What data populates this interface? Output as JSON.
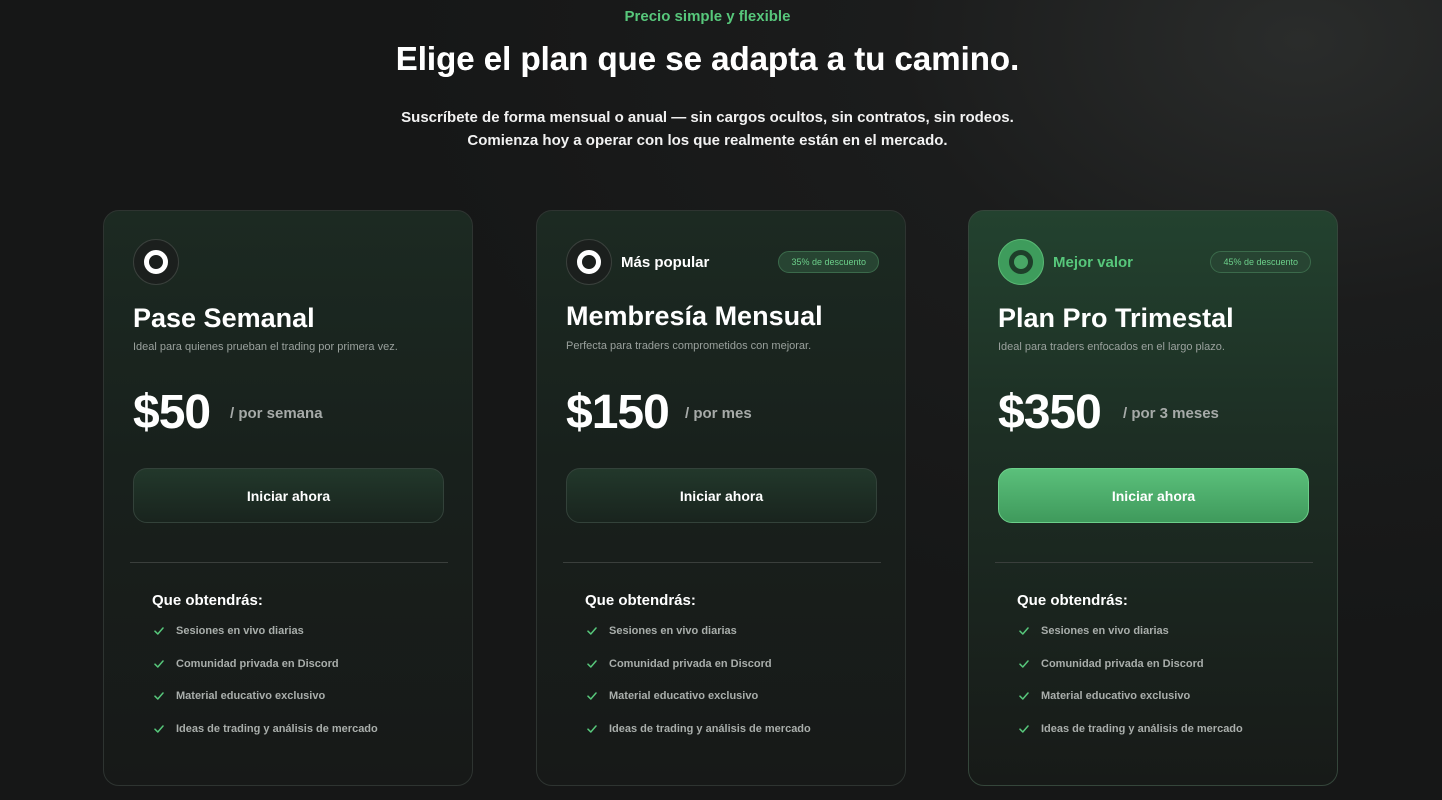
{
  "header": {
    "eyebrow": "Precio simple y flexible",
    "title": "Elige el plan que se adapta a tu camino.",
    "subtitle_line1": "Suscríbete de forma mensual o anual — sin cargos ocultos, sin contratos, sin rodeos.",
    "subtitle_line2": "Comienza hoy a operar con los que realmente están en el mercado."
  },
  "colors": {
    "accent": "#57c77b",
    "background": "#1b1c1c",
    "card": "#1c2a22",
    "highlight_card": "#23422f"
  },
  "plans": [
    {
      "icon": "ring-icon",
      "tag": "",
      "discount": "",
      "name": "Pase Semanal",
      "description": "Ideal para quienes prueban el trading por primera vez.",
      "price": "$50",
      "period": "/ por semana",
      "cta": "Iniciar ahora",
      "features_title": "Que obtendrás:",
      "features": [
        "Sesiones en vivo diarias",
        "Comunidad privada en Discord",
        "Material educativo exclusivo",
        "Ideas de trading y análisis de mercado"
      ]
    },
    {
      "icon": "ring-icon",
      "tag": "Más popular",
      "discount": "35% de descuento",
      "name": "Membresía Mensual",
      "description": "Perfecta para traders comprometidos con mejorar.",
      "price": "$150",
      "period": "/ por mes",
      "cta": "Iniciar ahora",
      "features_title": "Que obtendrás:",
      "features": [
        "Sesiones en vivo diarias",
        "Comunidad privada en Discord",
        "Material educativo exclusivo",
        "Ideas de trading y análisis de mercado"
      ]
    },
    {
      "icon": "ring-icon",
      "tag": "Mejor valor",
      "discount": "45% de descuento",
      "name": "Plan Pro Trimestal",
      "description": "Ideal para traders enfocados en el largo plazo.",
      "price": "$350",
      "period": "/ por 3 meses",
      "cta": "Iniciar ahora",
      "features_title": "Que obtendrás:",
      "features": [
        "Sesiones en vivo diarias",
        "Comunidad privada en Discord",
        "Material educativo exclusivo",
        "Ideas de trading y análisis de mercado"
      ]
    }
  ]
}
